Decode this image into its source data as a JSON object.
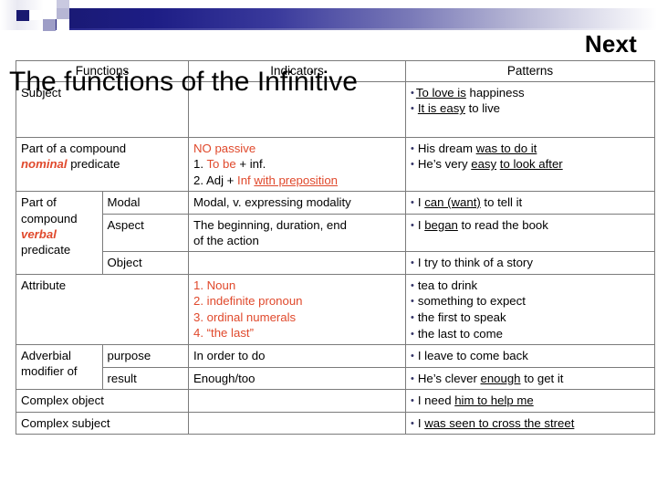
{
  "slide": {
    "title": "The functions of the Infinitive",
    "next_label": "Next",
    "accent_color": "#e0492c",
    "band_color": "#191970",
    "bullet_color": "#333366"
  },
  "table": {
    "headers": [
      "Functions",
      "Indicators",
      "Patterns"
    ],
    "rows": [
      {
        "function": "Subject",
        "sub": "",
        "indicators": [],
        "patterns": [
          "To love is happiness",
          "It is easy to live"
        ],
        "pattern_underlines": [
          "To love is",
          "It is easy"
        ],
        "pattern_tails": [
          " happiness",
          " to live"
        ]
      },
      {
        "function_line1": "Part of a compound",
        "function_em": "nominal",
        "function_line2_tail": " predicate",
        "indicators": [
          "NO passive",
          "1. To be + inf.",
          "2. Adj + Inf with preposition"
        ],
        "ind_1_num": "1. ",
        "ind_1_red": "To be",
        "ind_1_tail": " + inf.",
        "ind_2_num": "2. ",
        "ind_2_black": "Adj + ",
        "ind_2_red": "Inf ",
        "ind_2_redu": "with preposition",
        "patterns": [
          "His dream was to do it",
          "He’s very easy to look after"
        ],
        "p1_plain": "His dream ",
        "p1_u": "was to do it",
        "p2_plain": "He’s very ",
        "p2_u1": "easy",
        "p2_mid": " ",
        "p2_u2": "to look after"
      },
      {
        "function": "Part of compound verbal predicate",
        "function_l1": "Part of",
        "function_l2": "compound",
        "function_em": "verbal",
        "function_l4": "predicate",
        "subrows": [
          {
            "sub": "Modal",
            "indicator": "Modal, v. expressing modality",
            "pattern_plain_a": "I ",
            "pattern_u": "can (want)",
            "pattern_plain_b": " to tell it"
          },
          {
            "sub": "Aspect",
            "indicator_l1": "The beginning, duration, end",
            "indicator_l2": "of the action",
            "pattern_plain_a": "I ",
            "pattern_u": "began",
            "pattern_plain_b": " to read the book"
          },
          {
            "sub": "Object",
            "indicator": "",
            "pattern_plain_a": "I try to think of a story",
            "pattern_u": "",
            "pattern_plain_b": ""
          }
        ]
      },
      {
        "function": "Attribute",
        "indicators": [
          "1. Noun",
          "2. indefinite pronoun",
          "3. ordinal numerals",
          "4. “the last”"
        ],
        "patterns": [
          "tea to drink",
          "something to expect",
          "the first to speak",
          "the last to come"
        ]
      },
      {
        "function_l1": "Adverbial",
        "function_l2": "modifier of",
        "subrows": [
          {
            "sub": "purpose",
            "indicator": "In order to do",
            "indicator_red": false,
            "pattern_plain_a": "I leave to come back",
            "pattern_u": "",
            "pattern_plain_b": ""
          },
          {
            "sub": "result",
            "indicator": "Enough/too",
            "indicator_red": true,
            "pattern_plain_a": "He’s clever ",
            "pattern_u": "enough",
            "pattern_plain_b": " to get it"
          }
        ]
      },
      {
        "function": "Complex object",
        "indicators": [],
        "pattern_plain_a": "I need ",
        "pattern_u": "him to help me",
        "pattern_plain_b": ""
      },
      {
        "function": "Complex subject",
        "indicators": [],
        "pattern_plain_a": "I ",
        "pattern_u": "was seen to cross the street",
        "pattern_plain_b": ""
      }
    ]
  }
}
